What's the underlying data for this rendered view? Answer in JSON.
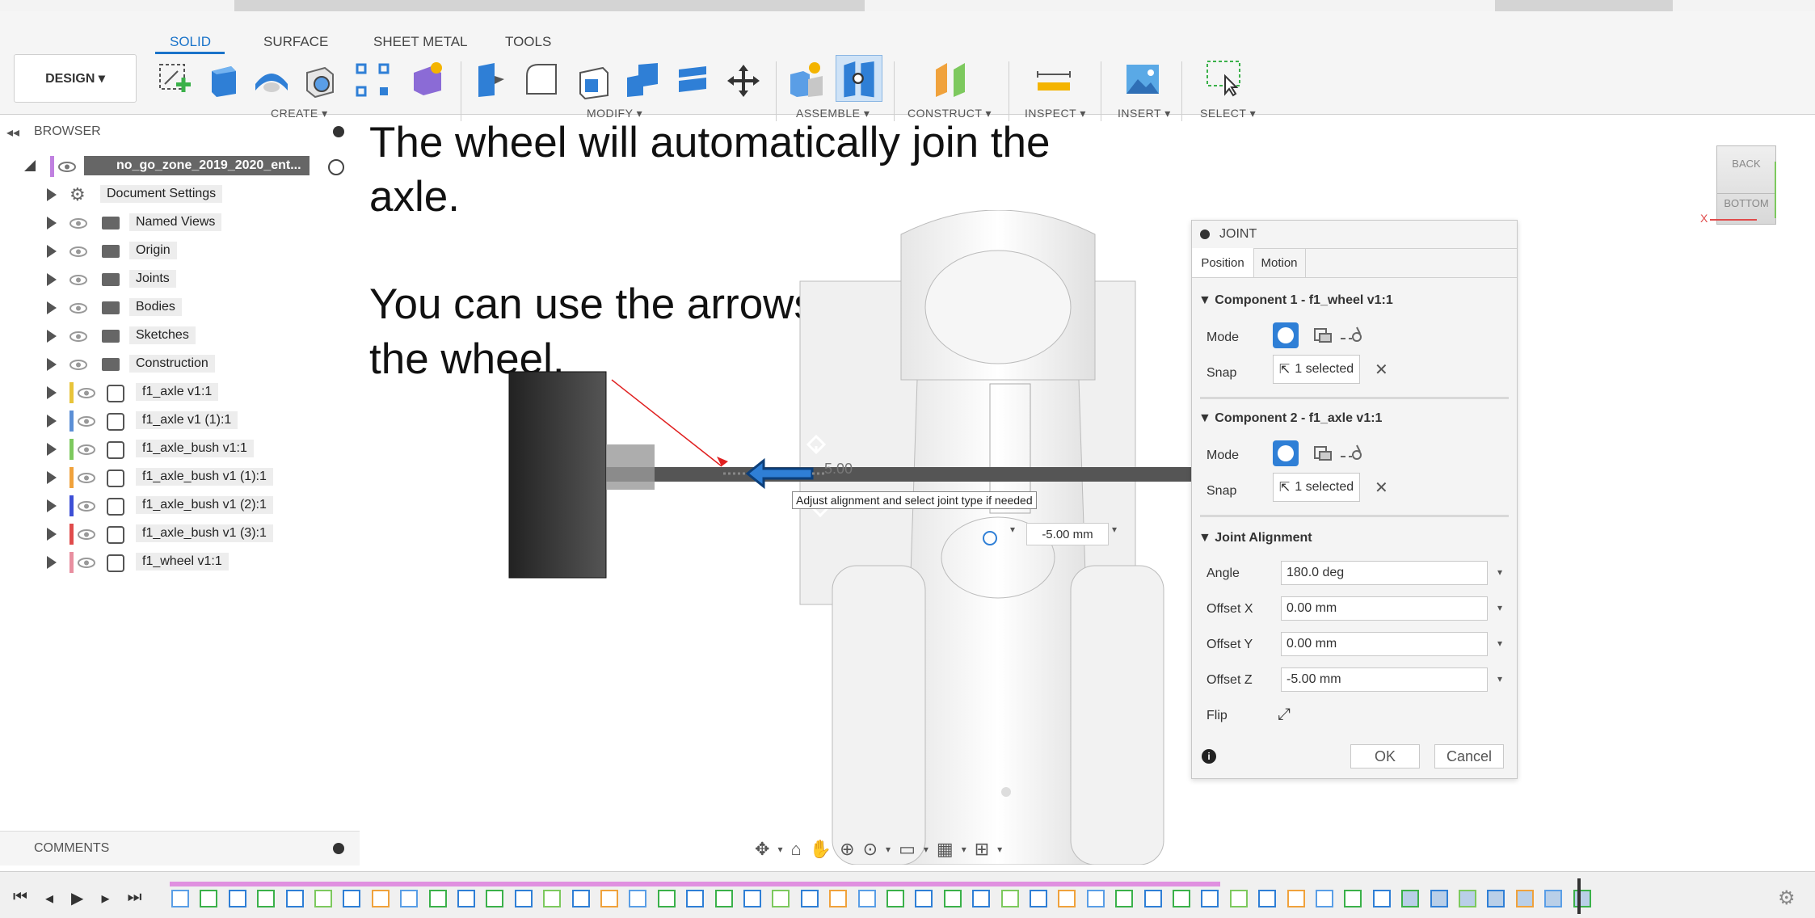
{
  "toolbar": {
    "tabs": [
      "SOLID",
      "SURFACE",
      "SHEET METAL",
      "TOOLS"
    ],
    "active_tab": "SOLID",
    "workspace_button": "DESIGN ▾",
    "groups": [
      "CREATE ▾",
      "MODIFY ▾",
      "ASSEMBLE ▾",
      "CONSTRUCT ▾",
      "INSPECT ▾",
      "INSERT ▾",
      "SELECT ▾"
    ]
  },
  "browser": {
    "title": "BROWSER",
    "root": "no_go_zone_2019_2020_ent...",
    "items": [
      {
        "label": "Document Settings",
        "icon": "gear-icon",
        "color": ""
      },
      {
        "label": "Named Views",
        "icon": "folder-icon",
        "color": ""
      },
      {
        "label": "Origin",
        "icon": "folder-icon",
        "color": ""
      },
      {
        "label": "Joints",
        "icon": "folder-icon",
        "color": ""
      },
      {
        "label": "Bodies",
        "icon": "folder-icon",
        "color": ""
      },
      {
        "label": "Sketches",
        "icon": "folder-icon",
        "color": ""
      },
      {
        "label": "Construction",
        "icon": "folder-icon",
        "color": ""
      },
      {
        "label": "f1_axle v1:1",
        "icon": "component-icon",
        "color": "#e8c43a"
      },
      {
        "label": "f1_axle v1 (1):1",
        "icon": "component-icon",
        "color": "#5b8fd6"
      },
      {
        "label": "f1_axle_bush v1:1",
        "icon": "component-icon",
        "color": "#7dc95e"
      },
      {
        "label": "f1_axle_bush v1 (1):1",
        "icon": "component-icon",
        "color": "#f0a23c"
      },
      {
        "label": "f1_axle_bush v1 (2):1",
        "icon": "component-icon",
        "color": "#3d4fd6"
      },
      {
        "label": "f1_axle_bush v1 (3):1",
        "icon": "component-icon",
        "color": "#e04b4b"
      },
      {
        "label": "f1_wheel v1:1",
        "icon": "component-icon",
        "color": "#e88fa0"
      }
    ]
  },
  "overlay": {
    "line1": "The wheel will automatically join the",
    "line2": "axle.",
    "line3": "You can use the arrows to position",
    "line4": "the wheel."
  },
  "canvas": {
    "tooltip": "Adjust alignment and select joint type if needed",
    "distance_value": "-5.00 mm",
    "ghost_value": "5.00",
    "viewcube_back": "BACK",
    "viewcube_bottom": "BOTTOM",
    "axis_x": "X"
  },
  "joint": {
    "title": "JOINT",
    "tabs": [
      "Position",
      "Motion"
    ],
    "component1": {
      "heading": "▼ Component 1 - f1_wheel v1:1",
      "mode_label": "Mode",
      "snap_label": "Snap",
      "snap_value": "1 selected"
    },
    "component2": {
      "heading": "▼ Component 2 - f1_axle v1:1",
      "mode_label": "Mode",
      "snap_label": "Snap",
      "snap_value": "1 selected"
    },
    "alignment": {
      "heading": "▼ Joint Alignment",
      "angle_label": "Angle",
      "angle_value": "180.0 deg",
      "offx_label": "Offset X",
      "offx_value": "0.00 mm",
      "offy_label": "Offset Y",
      "offy_value": "0.00 mm",
      "offz_label": "Offset Z",
      "offz_value": "-5.00 mm",
      "flip_label": "Flip"
    },
    "ok": "OK",
    "cancel": "Cancel"
  },
  "comments": {
    "title": "COMMENTS"
  }
}
